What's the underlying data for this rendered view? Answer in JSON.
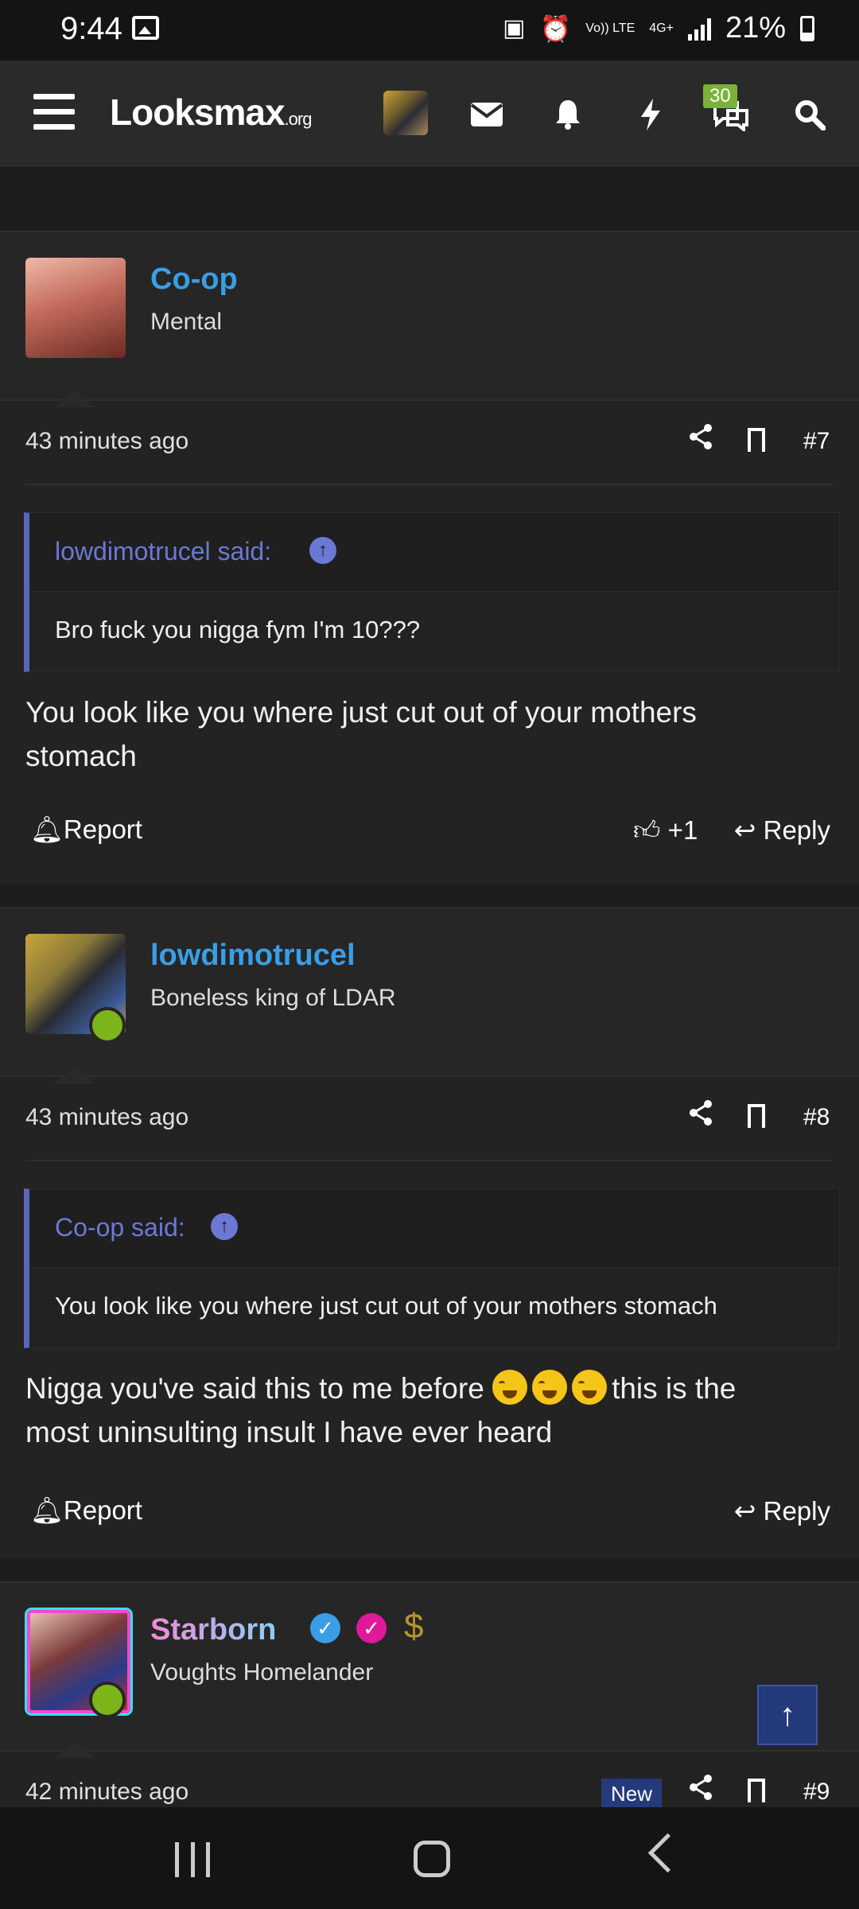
{
  "status_bar": {
    "time": "9:44",
    "battery": "21%",
    "network": "4G+",
    "volte": "Vo)) LTE"
  },
  "header": {
    "logo_main": "Looksmax",
    "logo_suffix": ".org",
    "alerts_badge": "30"
  },
  "posts": [
    {
      "username": "Co-op",
      "user_title": "Mental",
      "time": "43 minutes ago",
      "number": "#7",
      "quote_author": "lowdimotrucel said:",
      "quote_text": "Bro fuck you nigga fym I'm 10???",
      "message_line1": "You look like you where just cut out of your mothers",
      "message_line2": "stomach",
      "report_label": "Report",
      "like_count": "+1",
      "reply_label": "Reply"
    },
    {
      "username": "lowdimotrucel",
      "user_title": "Boneless king of LDAR",
      "time": "43 minutes ago",
      "number": "#8",
      "quote_author": "Co-op said:",
      "quote_text": "You look like you where just cut out of your mothers stomach",
      "message_before_emoji": "Nigga you've said this to me before",
      "message_after_emoji": "this is the",
      "message_line2": "most uninsulting insult I have ever heard",
      "report_label": "Report",
      "reply_label": "Reply"
    },
    {
      "username": "Starborn",
      "user_title": "Voughts Homelander",
      "time": "42 minutes ago",
      "new_label": "New",
      "number": "#9"
    }
  ],
  "colors": {
    "username": "#3a9ee6",
    "quote": "#6c79d4",
    "accent_bar": "#5a66b8",
    "online": "#7bb51a",
    "starborn_name": "#f08ad8"
  }
}
